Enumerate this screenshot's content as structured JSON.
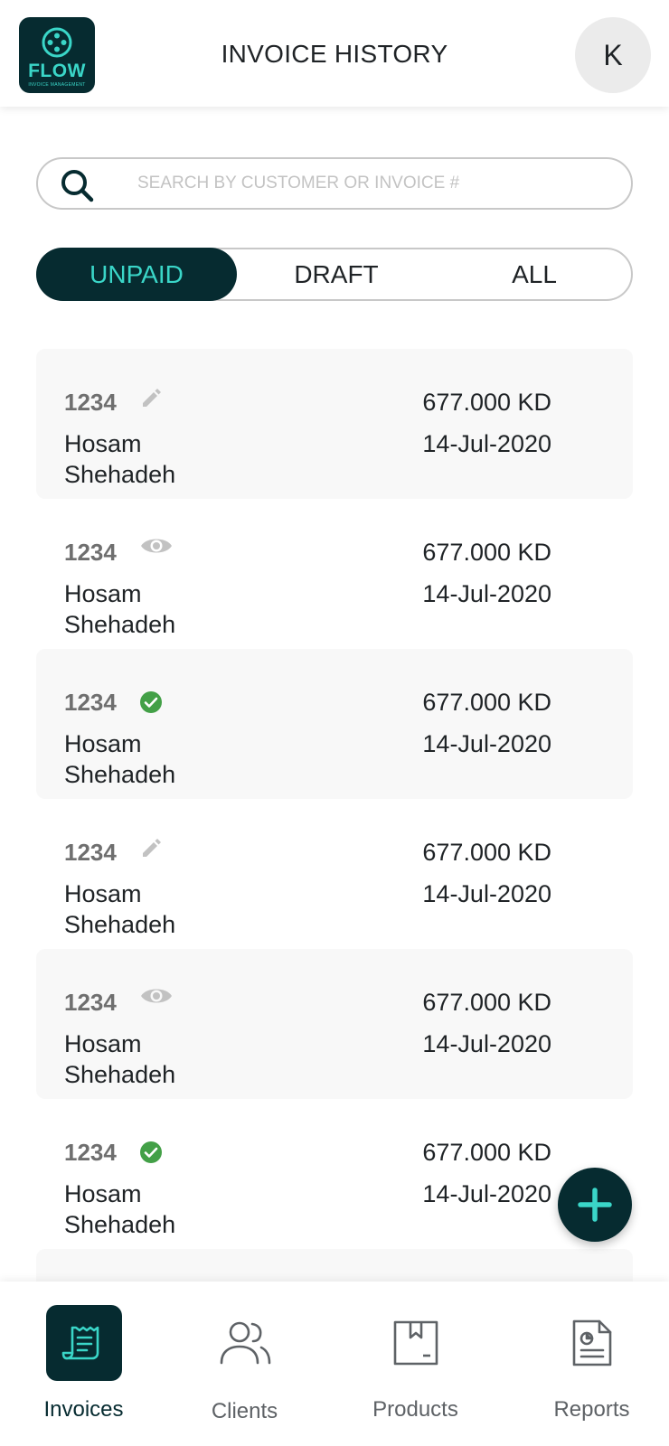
{
  "header": {
    "logo_text": "FLOW",
    "logo_subtext": "INVOICE MANAGEMENT",
    "title": "INVOICE HISTORY",
    "avatar_initial": "K"
  },
  "search": {
    "placeholder": "SEARCH BY CUSTOMER OR INVOICE #",
    "value": ""
  },
  "filters": {
    "tabs": [
      "UNPAID",
      "DRAFT",
      "ALL"
    ],
    "selected": "UNPAID"
  },
  "invoices": [
    {
      "number": "1234",
      "status_icon": "edit-icon",
      "client": "Hosam Shehadeh",
      "amount": "677.000 KD",
      "date": "14-Jul-2020"
    },
    {
      "number": "1234",
      "status_icon": "view-icon",
      "client": "Hosam Shehadeh",
      "amount": "677.000 KD",
      "date": "14-Jul-2020"
    },
    {
      "number": "1234",
      "status_icon": "paid-check-icon",
      "client": "Hosam Shehadeh",
      "amount": "677.000 KD",
      "date": "14-Jul-2020"
    },
    {
      "number": "1234",
      "status_icon": "edit-icon",
      "client": "Hosam Shehadeh",
      "amount": "677.000 KD",
      "date": "14-Jul-2020"
    },
    {
      "number": "1234",
      "status_icon": "view-icon",
      "client": "Hosam Shehadeh",
      "amount": "677.000 KD",
      "date": "14-Jul-2020"
    },
    {
      "number": "1234",
      "status_icon": "paid-check-icon",
      "client": "Hosam Shehadeh",
      "amount": "677.000 KD",
      "date": "14-Jul-2020"
    }
  ],
  "fab": {
    "icon": "plus-icon"
  },
  "bottom_nav": {
    "items": [
      {
        "label": "Invoices",
        "icon": "receipt-icon"
      },
      {
        "label": "Clients",
        "icon": "users-icon"
      },
      {
        "label": "Products",
        "icon": "box-icon"
      },
      {
        "label": "Reports",
        "icon": "report-icon"
      }
    ],
    "selected": "Invoices"
  },
  "colors": {
    "brand_dark": "#062b30",
    "brand_accent": "#3ad6c8",
    "paid_green": "#43a047",
    "icon_gray": "#c2c2c2",
    "card_shade": "#f8f8f8"
  }
}
